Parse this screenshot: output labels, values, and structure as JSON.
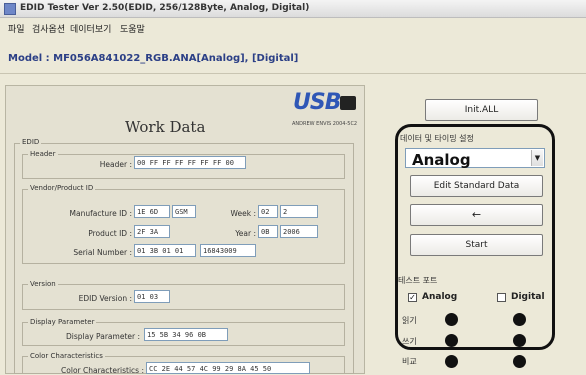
{
  "window": {
    "title": "EDID Tester Ver 2.50(EDID, 256/128Byte, Analog, Digital)"
  },
  "menu": [
    "파일",
    "검사옵션",
    "데이터보기",
    "도움말"
  ],
  "model": {
    "text": "Model : MF056A841022_RGB.ANA[Analog], [Digital]"
  },
  "logo": {
    "word": "USB",
    "subtitle": "ANDREW ENVIS 2004-5C2"
  },
  "work_title": "Work Data",
  "edid": {
    "group_label": "EDID",
    "header": {
      "group_label": "Header",
      "label": "Header :",
      "value": "00 FF FF FF FF FF FF 00"
    },
    "vendor": {
      "group_label": "Vendor/Product ID",
      "manufacture_label": "Manufacture ID :",
      "manufacture_value": "1E 6D",
      "manufacture_code": "GSM",
      "week_label": "Week :",
      "week_hex": "02",
      "week_dec": "2",
      "product_label": "Product ID :",
      "product_value": "2F 3A",
      "year_label": "Year :",
      "year_hex": "0B",
      "year_dec": "2006",
      "serial_label": "Serial Number :",
      "serial_hex": "01 3B 01 01",
      "serial_dec": "16843009"
    },
    "version": {
      "group_label": "Version",
      "label": "EDID Version :",
      "value": "01 03"
    },
    "display": {
      "group_label": "Display Parameter",
      "label": "Display Parameter :",
      "value": "15 5B 34 96 0B"
    },
    "color": {
      "group_label": "Color Characteristics",
      "label": "Color Characteristics :",
      "value": "CC 2E 44 57 4C 99 29 8A 45 50"
    }
  },
  "right": {
    "init_label": "Init.ALL",
    "data_select_label": "데이터 및 타이밍 설정",
    "combo_value": "Analog",
    "edit_label": "Edit Standard Data",
    "arrow_label": "←",
    "start_label": "Start",
    "test_label": "테스트 포트",
    "analog_label": "Analog",
    "digital_label": "Digital",
    "rows": [
      "읽기",
      "쓰기",
      "비교"
    ],
    "analog_checked": "✓"
  }
}
